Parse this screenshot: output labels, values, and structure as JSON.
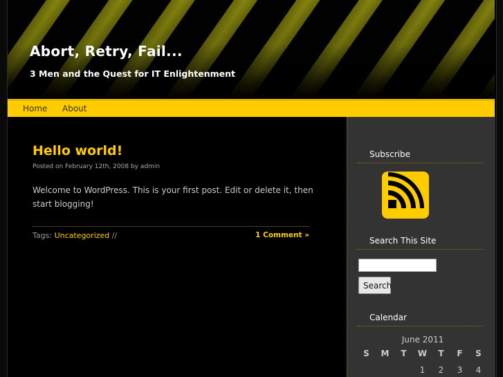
{
  "site": {
    "title": "Abort, Retry, Fail...",
    "tagline": "3 Men and the Quest for IT Enlightenment"
  },
  "nav": {
    "items": [
      {
        "label": "Home"
      },
      {
        "label": "About"
      }
    ]
  },
  "post": {
    "title": "Hello world!",
    "meta": "Posted on February 12th, 2008 by admin",
    "body": "Welcome to WordPress. This is your first post. Edit or delete it, then start blogging!",
    "tags_label": "Tags:",
    "tag": "Uncategorized",
    "tag_separator": "//",
    "comments_link": "1 Comment »"
  },
  "sidebar": {
    "subscribe_title": "Subscribe",
    "rss_icon": "rss-feed-icon",
    "search_title": "Search This Site",
    "search_input_value": "",
    "search_button": "Search",
    "calendar_title": "Calendar",
    "calendar": {
      "caption": "June 2011",
      "weekdays": [
        "S",
        "M",
        "T",
        "W",
        "T",
        "F",
        "S"
      ],
      "first_row": [
        "",
        "",
        "",
        "1",
        "2",
        "3",
        "4"
      ]
    }
  },
  "colors": {
    "accent": "#ffcc00",
    "background": "#000000",
    "sidebar_bg": "#333333",
    "stripe": "#8a8a10"
  }
}
